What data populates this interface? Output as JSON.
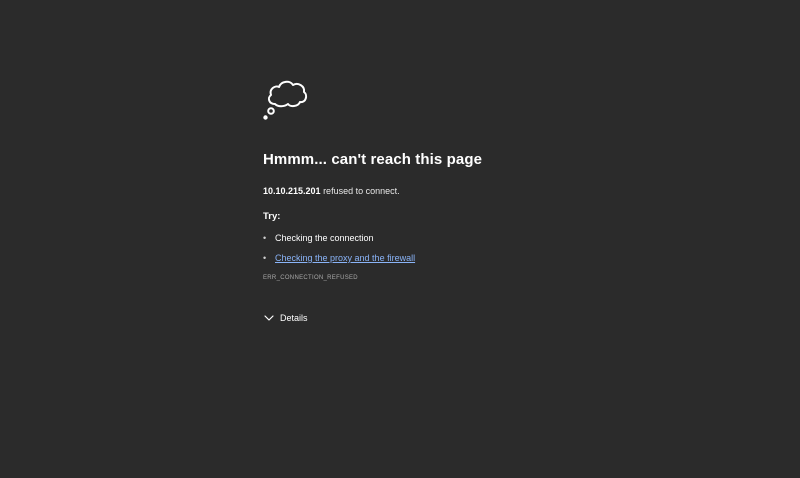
{
  "error": {
    "icon": "thought-cloud-icon",
    "title": "Hmmm... can't reach this page",
    "host": "10.10.215.201",
    "message_suffix": " refused to connect.",
    "try_label": "Try:",
    "suggestions": [
      {
        "label": "Checking the connection",
        "is_link": false
      },
      {
        "label": "Checking the proxy and the firewall",
        "is_link": true
      }
    ],
    "error_code": "ERR_CONNECTION_REFUSED",
    "details_label": "Details",
    "details_icon": "chevron-down-icon"
  },
  "colors": {
    "background": "#2b2b2b",
    "text": "#ffffff",
    "link": "#8ab4f8",
    "muted": "#a8a8a8"
  }
}
